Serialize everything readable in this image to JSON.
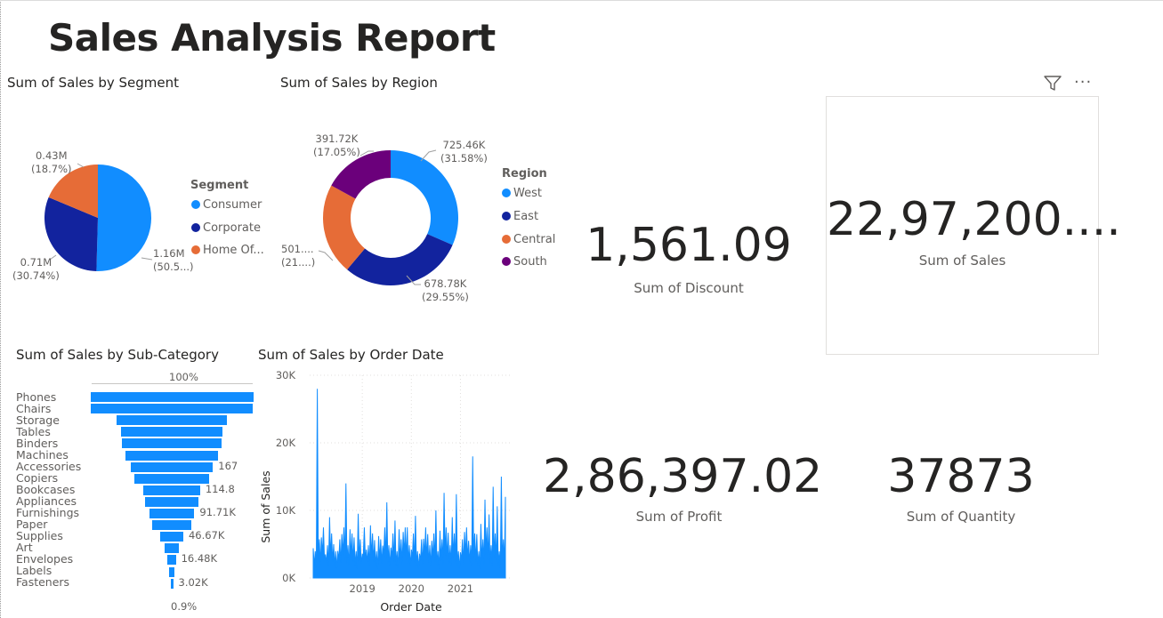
{
  "report": {
    "title": "Sales Analysis Report"
  },
  "colors": {
    "blue": "#118DFF",
    "navy": "#12239E",
    "orange": "#E66C37",
    "purple": "#6B007B"
  },
  "segment_chart": {
    "title": "Sum of Sales by Segment",
    "legend_title": "Segment",
    "legend": [
      "Consumer",
      "Corporate",
      "Home Of..."
    ],
    "labels": [
      {
        "value": "1.16M",
        "pct": "(50.5...)"
      },
      {
        "value": "0.71M",
        "pct": "(30.74%)"
      },
      {
        "value": "0.43M",
        "pct": "(18.7%)"
      }
    ]
  },
  "region_chart": {
    "title": "Sum of Sales by Region",
    "legend_title": "Region",
    "legend": [
      "West",
      "East",
      "Central",
      "South"
    ],
    "labels": [
      {
        "value": "725.46K",
        "pct": "(31.58%)"
      },
      {
        "value": "678.78K",
        "pct": "(29.55%)"
      },
      {
        "value": "501....",
        "pct": "(21....)"
      },
      {
        "value": "391.72K",
        "pct": "(17.05%)"
      }
    ]
  },
  "funnel_chart": {
    "title": "Sum of Sales by Sub-Category",
    "top_label": "100%",
    "bottom_label": "0.9%",
    "categories": [
      "Phones",
      "Chairs",
      "Storage",
      "Tables",
      "Binders",
      "Machines",
      "Accessories",
      "Copiers",
      "Bookcases",
      "Appliances",
      "Furnishings",
      "Paper",
      "Supplies",
      "Art",
      "Envelopes",
      "Labels",
      "Fasteners"
    ],
    "visible_value_labels": [
      {
        "row": 6,
        "text": "167"
      },
      {
        "row": 8,
        "text": "114.8"
      },
      {
        "row": 10,
        "text": "91.71K"
      },
      {
        "row": 12,
        "text": "46.67K"
      },
      {
        "row": 14,
        "text": "16.48K"
      },
      {
        "row": 16,
        "text": "3.02K"
      }
    ]
  },
  "date_chart": {
    "title": "Sum of Sales by Order Date",
    "xlabel": "Order Date",
    "ylabel": "Sum of Sales",
    "y_ticks": [
      "0K",
      "10K",
      "20K",
      "30K"
    ],
    "x_ticks": [
      "2019",
      "2020",
      "2021"
    ]
  },
  "chart_data": [
    {
      "type": "pie",
      "title": "Sum of Sales by Segment",
      "categories": [
        "Consumer",
        "Corporate",
        "Home Office"
      ],
      "values": [
        1160000,
        710000,
        430000
      ],
      "percent": [
        50.5,
        30.74,
        18.7
      ],
      "legend_position": "right"
    },
    {
      "type": "pie",
      "title": "Sum of Sales by Region",
      "donut": true,
      "categories": [
        "West",
        "East",
        "Central",
        "South"
      ],
      "values": [
        725460,
        678780,
        501240,
        391720
      ],
      "percent": [
        31.58,
        29.55,
        21.82,
        17.05
      ],
      "legend_position": "right"
    },
    {
      "type": "bar",
      "title": "Sum of Sales by Sub-Category",
      "orientation": "funnel",
      "categories": [
        "Phones",
        "Chairs",
        "Storage",
        "Tables",
        "Binders",
        "Machines",
        "Accessories",
        "Copiers",
        "Bookcases",
        "Appliances",
        "Furnishings",
        "Paper",
        "Supplies",
        "Art",
        "Envelopes",
        "Labels",
        "Fasteners"
      ],
      "values": [
        330000,
        328000,
        224000,
        207000,
        203000,
        189000,
        167000,
        150000,
        114880,
        107500,
        91710,
        78480,
        46670,
        27120,
        16480,
        12490,
        3020
      ]
    },
    {
      "type": "line",
      "title": "Sum of Sales by Order Date",
      "xlabel": "Order Date",
      "ylabel": "Sum of Sales",
      "ylim": [
        0,
        30000
      ],
      "x": [
        "2018-01",
        "2018-02",
        "2018-03",
        "2018-04",
        "2018-05",
        "2018-06",
        "2018-07",
        "2018-08",
        "2018-09",
        "2018-10",
        "2018-11",
        "2018-12",
        "2019-01",
        "2019-02",
        "2019-03",
        "2019-04",
        "2019-05",
        "2019-06",
        "2019-07",
        "2019-08",
        "2019-09",
        "2019-10",
        "2019-11",
        "2019-12",
        "2020-01",
        "2020-02",
        "2020-03",
        "2020-04",
        "2020-05",
        "2020-06",
        "2020-07",
        "2020-08",
        "2020-09",
        "2020-10",
        "2020-11",
        "2020-12",
        "2021-01",
        "2021-02",
        "2021-03",
        "2021-04",
        "2021-05",
        "2021-06",
        "2021-07",
        "2021-08",
        "2021-09",
        "2021-10",
        "2021-11",
        "2021-12"
      ],
      "series": [
        {
          "name": "Sum of Sales",
          "values": [
            4400,
            28000,
            6000,
            3500,
            9000,
            5000,
            4000,
            6500,
            14000,
            7200,
            6000,
            9500,
            3500,
            4200,
            7800,
            5600,
            6200,
            4800,
            11200,
            4500,
            8500,
            7200,
            6800,
            7500,
            4200,
            9200,
            3600,
            5800,
            6500,
            5500,
            10000,
            7000,
            12600,
            6700,
            9000,
            12400,
            3800,
            6800,
            5500,
            18000,
            6500,
            8000,
            11600,
            9400,
            13500,
            10600,
            15000,
            12000
          ]
        }
      ]
    }
  ],
  "kpis": {
    "discount": {
      "value": "1,561.09",
      "label": "Sum of Discount"
    },
    "sales": {
      "value": "22,97,200....",
      "label": "Sum of Sales"
    },
    "profit": {
      "value": "2,86,397.02",
      "label": "Sum of Profit"
    },
    "quantity": {
      "value": "37873",
      "label": "Sum of Quantity"
    }
  },
  "visual_header": {
    "filter_icon": "filter-icon",
    "more_icon": "more-options-icon"
  }
}
